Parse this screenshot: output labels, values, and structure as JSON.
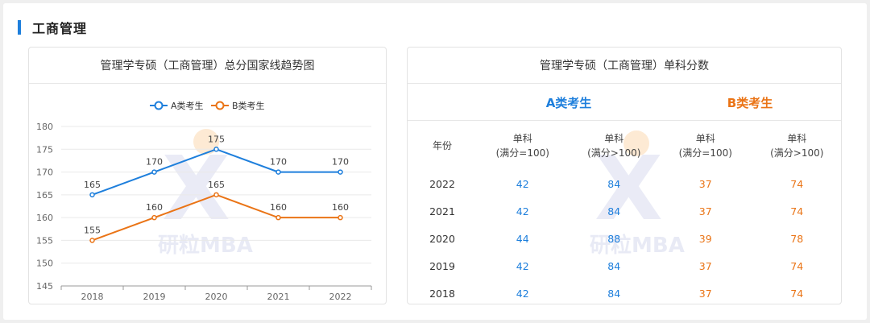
{
  "section": {
    "title": "工商管理"
  },
  "left_card": {
    "title": "管理学专硕（工商管理）总分国家线趋势图"
  },
  "right_card": {
    "title": "管理学专硕（工商管理）单科分数",
    "group_a": "A类考生",
    "group_b": "B类考生",
    "columns": [
      {
        "line1": "年份",
        "line2": ""
      },
      {
        "line1": "单科",
        "line2": "(满分=100)"
      },
      {
        "line1": "单科",
        "line2": "(满分>100)"
      },
      {
        "line1": "单科",
        "line2": "(满分=100)"
      },
      {
        "line1": "单科",
        "line2": "(满分>100)"
      }
    ],
    "rows": [
      {
        "year": "2022",
        "a100": "42",
        "a_gt100": "84",
        "b100": "37",
        "b_gt100": "74"
      },
      {
        "year": "2021",
        "a100": "42",
        "a_gt100": "84",
        "b100": "37",
        "b_gt100": "74"
      },
      {
        "year": "2020",
        "a100": "44",
        "a_gt100": "88",
        "b100": "39",
        "b_gt100": "78"
      },
      {
        "year": "2019",
        "a100": "42",
        "a_gt100": "84",
        "b100": "37",
        "b_gt100": "74"
      },
      {
        "year": "2018",
        "a100": "42",
        "a_gt100": "84",
        "b100": "37",
        "b_gt100": "74"
      }
    ]
  },
  "watermark": {
    "text": "研粒MBA",
    "glyph": "X"
  },
  "colors": {
    "series_a": "#1e7fdc",
    "series_b": "#ea7416",
    "accent": "#1e7fdc"
  },
  "chart_data": {
    "type": "line",
    "title": "管理学专硕（工商管理）总分国家线趋势图",
    "categories": [
      "2018",
      "2019",
      "2020",
      "2021",
      "2022"
    ],
    "series": [
      {
        "name": "A类考生",
        "values": [
          165,
          170,
          175,
          170,
          170
        ],
        "color": "#1e7fdc"
      },
      {
        "name": "B类考生",
        "values": [
          155,
          160,
          165,
          160,
          160
        ],
        "color": "#ea7416"
      }
    ],
    "ylim": [
      145,
      180
    ],
    "yticks": [
      145,
      150,
      155,
      160,
      165,
      170,
      175,
      180
    ],
    "xlabel": "",
    "ylabel": "",
    "grid": true,
    "legend": "top-center",
    "data_labels": true
  }
}
